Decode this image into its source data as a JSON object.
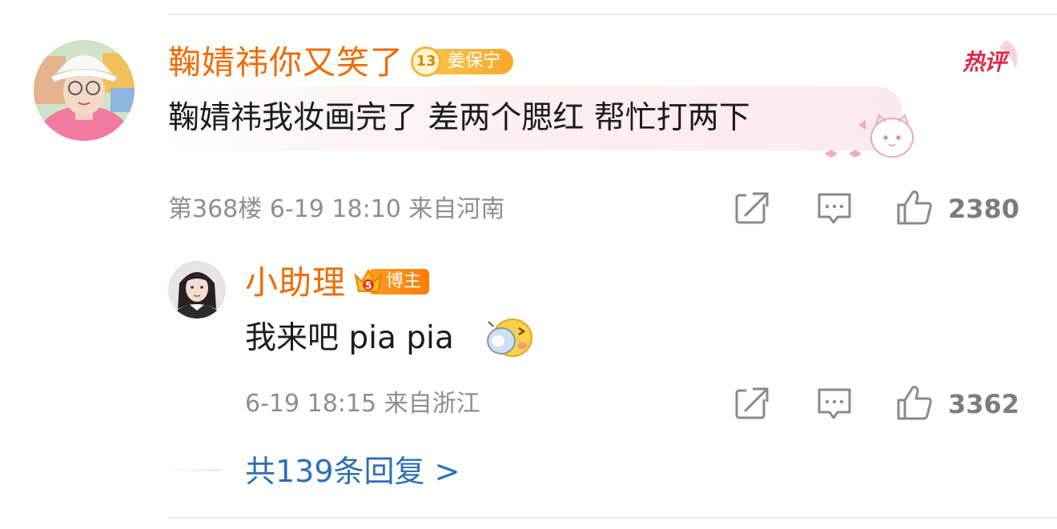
{
  "comment": {
    "username": "鞠婧祎你又笑了",
    "fan_badge": {
      "level": "13",
      "name": "姜保宁"
    },
    "hot_label": "热评",
    "text": "鞠婧祎我妆画完了 差两个腮红 帮忙打两下",
    "meta": "第368楼 6-19 18:10 来自河南",
    "likes": "2380"
  },
  "reply": {
    "username": "小助理",
    "badge": "博主",
    "text": "我来吧 pia pia",
    "meta": "6-19 18:15 来自浙江",
    "likes": "3362"
  },
  "more_replies": "共139条回复 >",
  "icons": {
    "share": "share-icon",
    "comment": "comment-icon",
    "like": "thumbs-up-icon",
    "emoji": "smack-face-emoji"
  },
  "colors": {
    "username": "#f26b00",
    "link": "#2e6fb3",
    "meta": "#8e8e8e",
    "hot": "#e0294a"
  }
}
